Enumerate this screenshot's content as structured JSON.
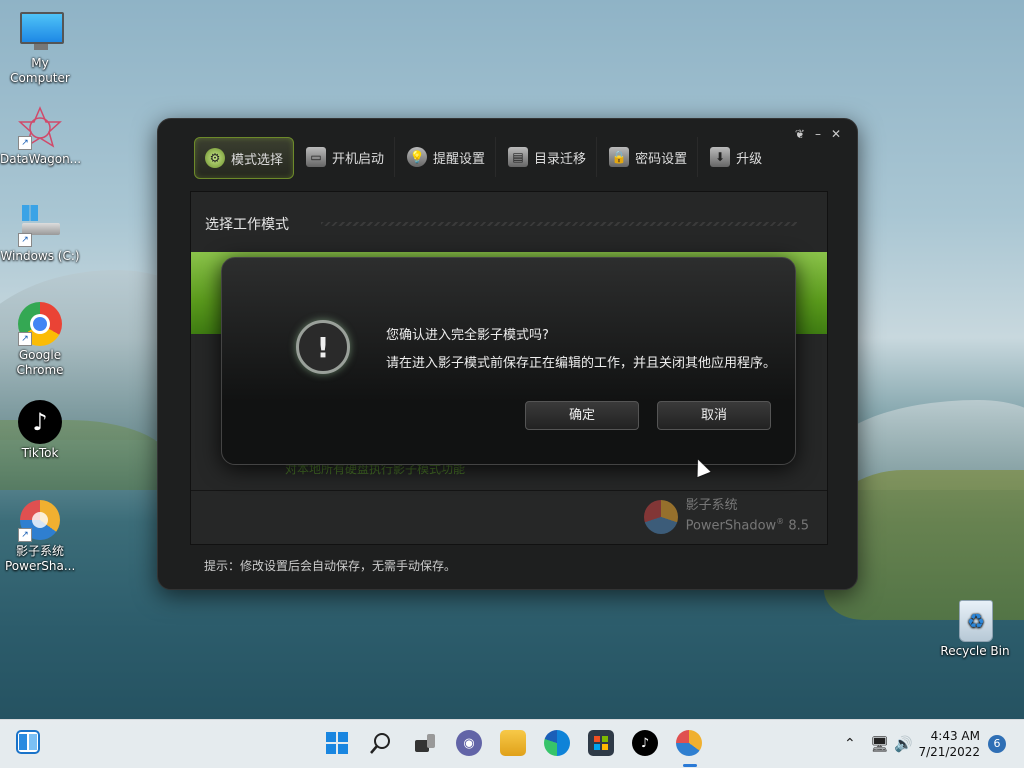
{
  "desktop": {
    "icons": [
      {
        "label": "My Computer"
      },
      {
        "label": "DataWagon..."
      },
      {
        "label": "Windows (C:)"
      },
      {
        "label": "Google Chrome"
      },
      {
        "label": "TikTok"
      },
      {
        "label": "影子系统 PowerSha..."
      },
      {
        "label": "Recycle Bin"
      }
    ]
  },
  "app": {
    "tabs": [
      {
        "label": "模式选择"
      },
      {
        "label": "开机启动"
      },
      {
        "label": "提醒设置"
      },
      {
        "label": "目录迁移"
      },
      {
        "label": "密码设置"
      },
      {
        "label": "升级"
      }
    ],
    "panel_title": "选择工作模式",
    "hint": "对本地所有硬盘执行影子模式功能",
    "brand_cn": "影子系统",
    "brand_en": "PowerShadow",
    "brand_version": "8.5",
    "brand_reg": "®",
    "footer_tip": "提示：修改设置后会自动保存，无需手动保存。",
    "window_controls": {
      "restore": "❦",
      "minimize": "–",
      "close": "✕"
    }
  },
  "dialog": {
    "question": "您确认进入完全影子模式吗?",
    "detail": "请在进入影子模式前保存正在编辑的工作，并且关闭其他应用程序。",
    "confirm": "确定",
    "cancel": "取消"
  },
  "taskbar": {
    "time": "4:43 AM",
    "date": "7/21/2022",
    "notification_count": "6"
  }
}
